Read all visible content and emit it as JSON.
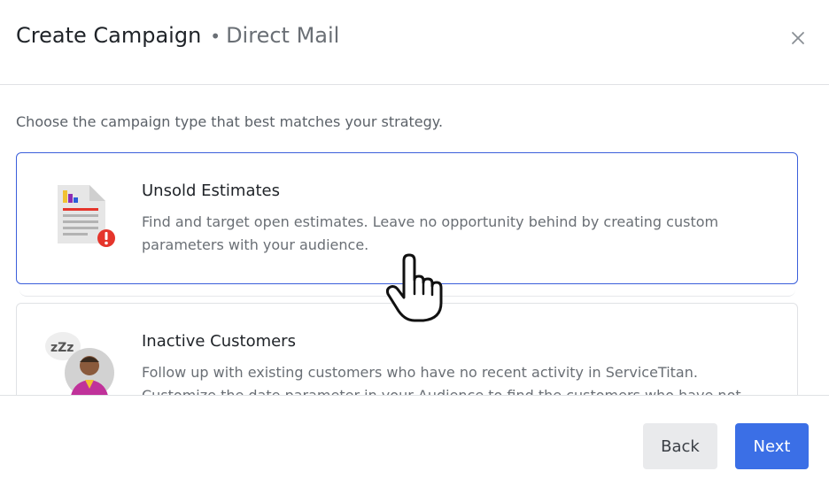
{
  "dialog": {
    "title": "Create Campaign",
    "separator": "•",
    "subtitle": "Direct Mail",
    "close_icon": "close-icon"
  },
  "content": {
    "lead": "Choose the campaign type that best matches your strategy.",
    "cards": [
      {
        "title": "Unsold Estimates",
        "description": "Find and target open estimates. Leave no opportunity behind by creating custom parameters with your audience.",
        "icon": "estimate-document-alert-icon",
        "selected": true
      },
      {
        "title": "Inactive Customers",
        "description": "Follow up with existing customers who have no recent activity in ServiceTitan. Customize the date parameter in your Audience to find the customers who have not called or booked a",
        "icon": "sleeping-customer-icon",
        "selected": false
      }
    ]
  },
  "footer": {
    "back_label": "Back",
    "next_label": "Next"
  },
  "colors": {
    "primary": "#3b6fe6",
    "selected_border": "#3b5fdb",
    "alert": "#e5352b"
  }
}
